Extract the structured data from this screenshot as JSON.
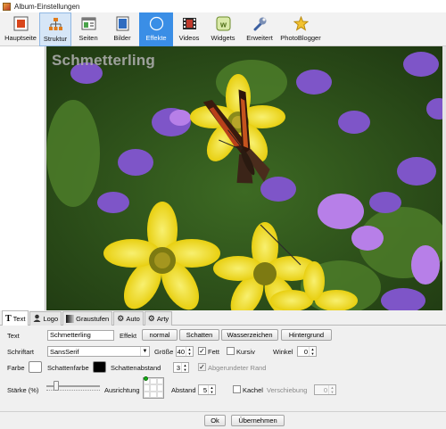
{
  "window": {
    "title": "Album-Einstellungen"
  },
  "toolbar": {
    "items": [
      {
        "label": "Hauptseite",
        "icon": "home-icon"
      },
      {
        "label": "Struktur",
        "icon": "structure-icon"
      },
      {
        "label": "Seiten",
        "icon": "pages-icon"
      },
      {
        "label": "Bilder",
        "icon": "images-icon"
      },
      {
        "label": "Effekte",
        "icon": "effects-icon"
      },
      {
        "label": "Videos",
        "icon": "videos-icon"
      },
      {
        "label": "Widgets",
        "icon": "widgets-icon"
      },
      {
        "label": "Erweitert",
        "icon": "advanced-icon"
      },
      {
        "label": "PhotoBlogger",
        "icon": "photoblogger-icon"
      }
    ],
    "active": "Effekte",
    "selected": "Struktur"
  },
  "preview": {
    "overlay_text": "Schmetterling"
  },
  "tabs": [
    {
      "label": "Text",
      "icon": "text-icon"
    },
    {
      "label": "Logo",
      "icon": "logo-icon"
    },
    {
      "label": "Graustufen",
      "icon": "grayscale-icon"
    },
    {
      "label": "Auto",
      "icon": "gear-icon"
    },
    {
      "label": "Arty",
      "icon": "gear-icon"
    }
  ],
  "form": {
    "text_label": "Text",
    "text_value": "Schmetterling",
    "effekt_label": "Effekt",
    "effect_buttons": [
      "normal",
      "Schatten",
      "Wasserzeichen",
      "Hintergrund"
    ],
    "schriftart_label": "Schriftart",
    "font_value": "SansSerif",
    "groesse_label": "Größe",
    "groesse_value": "40",
    "fett_label": "Fett",
    "fett_checked": true,
    "kursiv_label": "Kursiv",
    "kursiv_checked": false,
    "winkel_label": "Winkel",
    "winkel_value": "0",
    "farbe_label": "Farbe",
    "farbe_color": "#ffffff",
    "schattenfarbe_label": "Schattenfarbe",
    "schattenfarbe_color": "#000000",
    "schattenabstand_label": "Schattenabstand",
    "schattenabstand_value": "3",
    "abgerundeter_rand_label": "Abgerundeter Rand",
    "staerke_label": "Stärke (%)",
    "staerke_level": 0.15,
    "ausrichtung_label": "Ausrichtung",
    "abstand_label": "Abstand",
    "abstand_value": "5",
    "kachel_label": "Kachel",
    "verschiebung_label": "Verschiebung",
    "verschiebung_value": "0"
  },
  "footer": {
    "ok_label": "Ok",
    "apply_label": "Übernehmen"
  },
  "colors": {
    "accent": "#3a8ee6",
    "align_dot": "#15b315"
  }
}
